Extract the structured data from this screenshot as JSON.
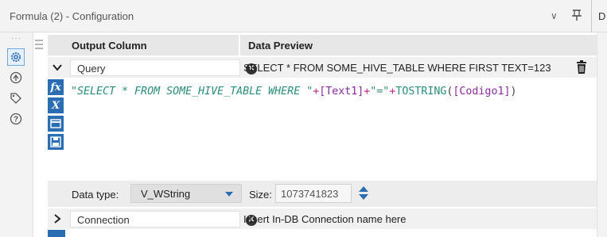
{
  "window": {
    "title": "Formula (2) - Configuration",
    "next_panel_letter": "D"
  },
  "sidebar": {
    "icons": [
      "gear-icon",
      "anchor-icon",
      "tag-icon",
      "help-icon"
    ]
  },
  "table": {
    "headers": {
      "output_column": "Output Column",
      "data_preview": "Data Preview"
    },
    "rows": [
      {
        "name": "Query",
        "preview": "SELECT * FROM SOME_HIVE_TABLE WHERE FIRST TEXT=123",
        "expanded": true
      },
      {
        "name": "Connection",
        "preview": "Insert In-DB Connection name here",
        "expanded": false
      }
    ]
  },
  "editor": {
    "tools": [
      "fx",
      "x",
      "table",
      "save"
    ],
    "expression": {
      "str1": "\"SELECT * FROM SOME_HIVE_TABLE WHERE \"",
      "plus1": "+",
      "field1": "[Text1]",
      "plus2": "+",
      "str2": "\"=\"",
      "plus3": "+",
      "fn": "TOSTRING",
      "paren_open": "(",
      "field2": "[Codigo1]",
      "paren_close": ")"
    }
  },
  "type_bar": {
    "data_type_label": "Data type:",
    "data_type_value": "V_WString",
    "size_label": "Size:",
    "size_value": "1073741823"
  },
  "colors": {
    "accent": "#2a6db3",
    "string_literal": "#2d8c7a",
    "field_ref": "#8a2b9c",
    "operator": "#c02080"
  }
}
